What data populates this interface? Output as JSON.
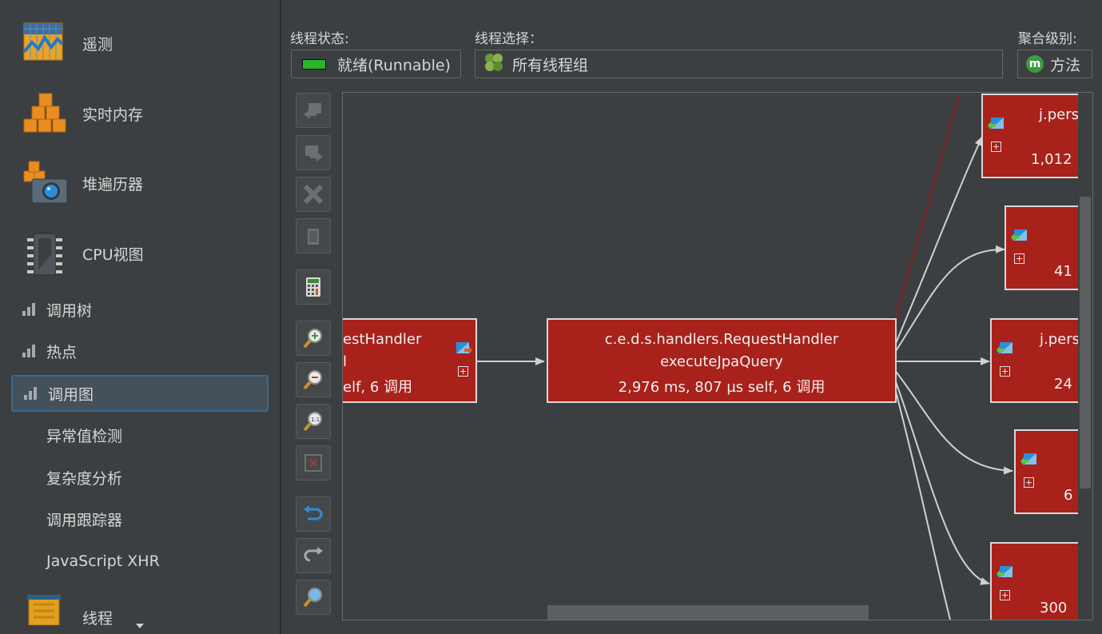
{
  "sidebar": {
    "primary": [
      {
        "label": "遥测",
        "icon": "telemetry-icon"
      },
      {
        "label": "实时内存",
        "icon": "memory-cubes-icon"
      },
      {
        "label": "堆遍历器",
        "icon": "heap-walker-camera-icon"
      },
      {
        "label": "CPU视图",
        "icon": "cpu-chip-icon"
      }
    ],
    "cpu_children": [
      {
        "label": "调用树",
        "icon": "bar-chart-icon"
      },
      {
        "label": "热点",
        "icon": "bar-chart-icon"
      },
      {
        "label": "调用图",
        "icon": "bar-chart-icon",
        "selected": true
      }
    ],
    "plain_children": [
      "异常值检测",
      "复杂度分析",
      "调用跟踪器",
      "JavaScript XHR"
    ],
    "threads": {
      "label": "线程",
      "icon": "threads-icon"
    }
  },
  "filters": {
    "thread_state_label": "线程状态:",
    "thread_state_value": "就绪(Runnable)",
    "thread_state_color": "#2ab52a",
    "thread_select_label": "线程选择：",
    "thread_select_value": "所有线程组",
    "aggregation_label": "聚合级别:",
    "aggregation_value": "方法",
    "aggregation_badge": "m"
  },
  "toolbar": {
    "buttons": [
      "navigate-back-icon",
      "navigate-forward-icon",
      "remove-node-icon",
      "delete-icon",
      "calculator-icon",
      "zoom-in-icon",
      "zoom-out-icon",
      "zoom-reset-icon",
      "fit-content-icon",
      "undo-icon",
      "redo-icon",
      "find-icon"
    ]
  },
  "graph": {
    "node_color": "#a8211b",
    "nodes": {
      "caller": {
        "line1": "estHandler",
        "line2": "l",
        "line3": "elf, 6 调用"
      },
      "center": {
        "line1": "c.e.d.s.handlers.RequestHandler",
        "line2": "executeJpaQuery",
        "line3": "2,976 ms, 807 µs self, 6 调用"
      },
      "callees": [
        {
          "title": "j.pers",
          "value": "1,012"
        },
        {
          "title": "",
          "value": "41"
        },
        {
          "title": "j.pers",
          "value": "24"
        },
        {
          "title": "",
          "value": "6"
        },
        {
          "title": "",
          "value": "300"
        }
      ]
    }
  }
}
